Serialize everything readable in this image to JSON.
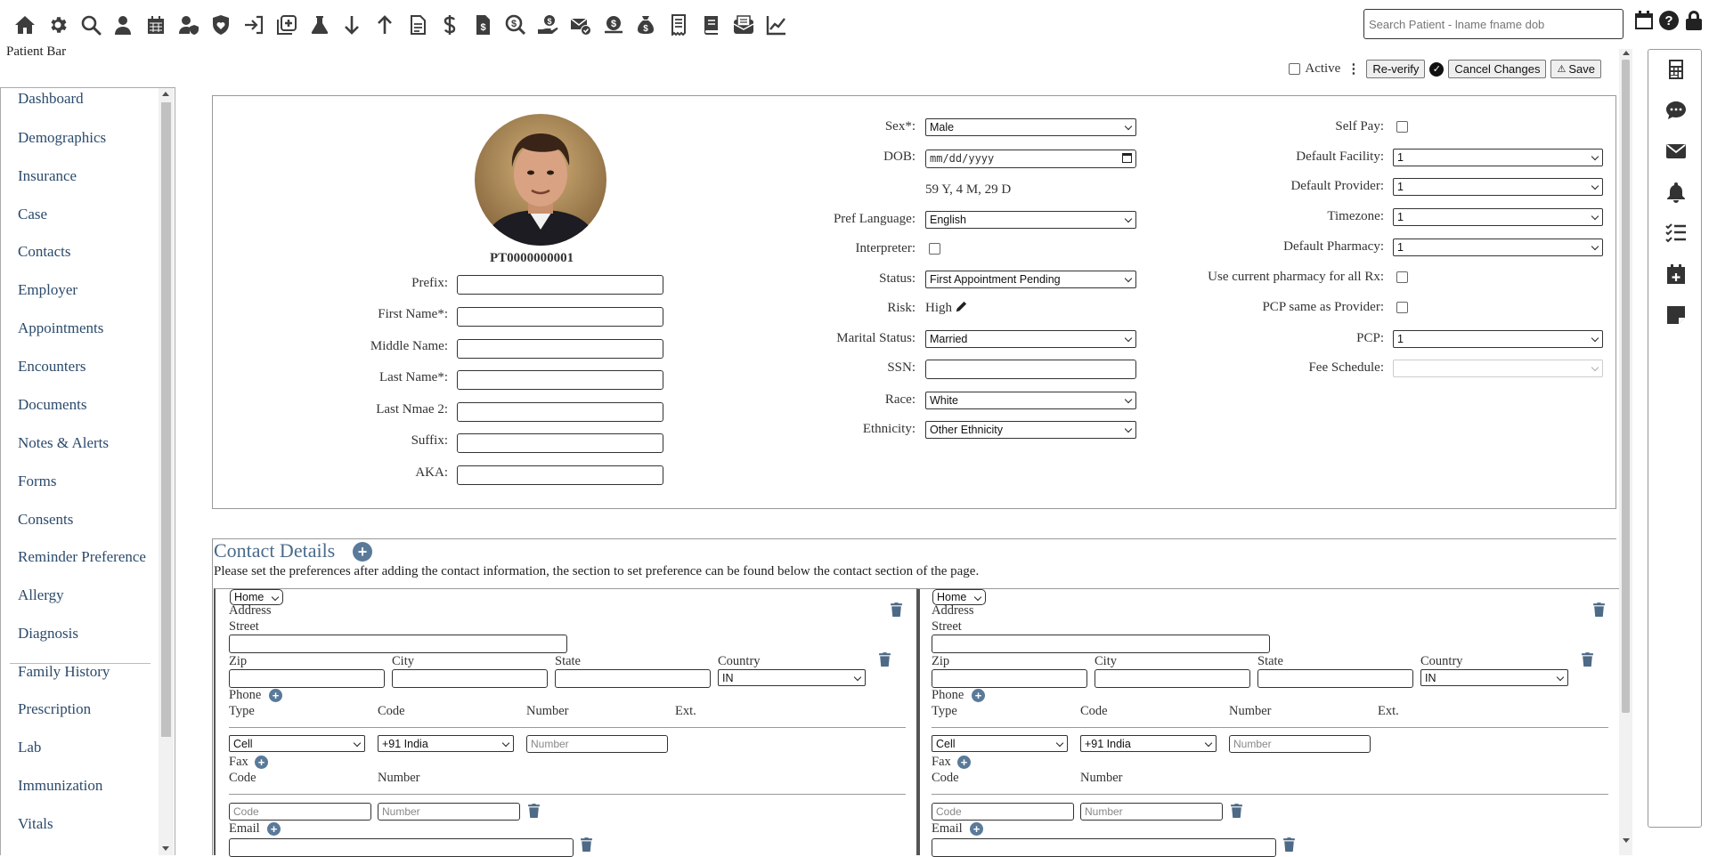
{
  "toolbar": {
    "icons": [
      "home-icon",
      "gear-icon",
      "search-icon",
      "user-icon",
      "calendar-icon",
      "user-shield-icon",
      "shield-heart-icon",
      "sign-in-icon",
      "medical-plus-icon",
      "flask-icon",
      "arrow-down-icon",
      "arrow-up-icon",
      "document-icon",
      "dollar-icon",
      "invoice-dollar-icon",
      "search-dollar-icon",
      "hand-holding-dollar-icon",
      "envelope-check-icon",
      "dollar-stack-icon",
      "money-bag-icon",
      "receipt-icon",
      "book-icon",
      "envelope-open-icon",
      "chart-line-icon"
    ],
    "patient_bar_label": "Patient Bar",
    "search_placeholder": "Search Patient - lname fname dob"
  },
  "actions": {
    "active_label": "Active",
    "reverify_label": "Re-verify",
    "cancel_label": "Cancel Changes",
    "save_label": "Save"
  },
  "sidebar": {
    "items": [
      "Dashboard",
      "Demographics",
      "Insurance",
      "Case",
      "Contacts",
      "Employer",
      "Appointments",
      "Encounters",
      "Documents",
      "Notes & Alerts",
      "Forms",
      "Consents",
      "Reminder Preference",
      "Allergy",
      "Diagnosis",
      "Family History",
      "Prescription",
      "Lab",
      "Immunization",
      "Vitals"
    ]
  },
  "patient": {
    "id": "PT0000000001",
    "name_fields": [
      "Prefix:",
      "First Name*:",
      "Middle Name:",
      "Last Name*:",
      "Last Nmae 2:",
      "Suffix:",
      "AKA:"
    ]
  },
  "demographics": {
    "sex_label": "Sex*:",
    "sex_value": "Male",
    "dob_label": "DOB:",
    "dob_placeholder": "mm/dd/yyyy",
    "age_text": "59 Y, 4 M, 29 D",
    "pref_language_label": "Pref Language:",
    "pref_language_value": "English",
    "interpreter_label": "Interpreter:",
    "status_label": "Status:",
    "status_value": "First Appointment Pending",
    "risk_label": "Risk:",
    "risk_value": "High",
    "marital_label": "Marital Status:",
    "marital_value": "Married",
    "ssn_label": "SSN:",
    "race_label": "Race:",
    "race_value": "White",
    "ethnicity_label": "Ethnicity:",
    "ethnicity_value": "Other Ethnicity"
  },
  "preferences": {
    "self_pay_label": "Self Pay:",
    "default_facility_label": "Default Facility:",
    "default_facility_value": "1",
    "default_provider_label": "Default Provider:",
    "default_provider_value": "1",
    "timezone_label": "Timezone:",
    "timezone_value": "1",
    "default_pharmacy_label": "Default Pharmacy:",
    "default_pharmacy_value": "1",
    "current_pharmacy_label": "Use current pharmacy for all Rx:",
    "pcp_same_label": "PCP same as Provider:",
    "pcp_label": "PCP:",
    "pcp_value": "1",
    "fee_schedule_label": "Fee Schedule:",
    "fee_schedule_value": ""
  },
  "contact": {
    "title": "Contact Details",
    "note": "Please set the preferences after adding the contact information, the section to set preference can be found below the contact section of the page.",
    "cards": [
      {
        "type_value": "Home",
        "address_label": "Address",
        "street_label": "Street",
        "zip_label": "Zip",
        "city_label": "City",
        "state_label": "State",
        "country_label": "Country",
        "country_value": "IN",
        "phone_label": "Phone",
        "phone_type_header": "Type",
        "phone_code_header": "Code",
        "phone_number_header": "Number",
        "phone_ext_header": "Ext.",
        "phone_type_value": "Cell",
        "phone_code_value": "+91 India",
        "phone_number_placeholder": "Number",
        "fax_label": "Fax",
        "fax_code_header": "Code",
        "fax_number_header": "Number",
        "fax_code_placeholder": "Code",
        "fax_number_placeholder": "Number",
        "email_label": "Email"
      },
      {
        "type_value": "Home",
        "address_label": "Address",
        "street_label": "Street",
        "zip_label": "Zip",
        "city_label": "City",
        "state_label": "State",
        "country_label": "Country",
        "country_value": "IN",
        "phone_label": "Phone",
        "phone_type_header": "Type",
        "phone_code_header": "Code",
        "phone_number_header": "Number",
        "phone_ext_header": "Ext.",
        "phone_type_value": "Cell",
        "phone_code_value": "+91 India",
        "phone_number_placeholder": "Number",
        "fax_label": "Fax",
        "fax_code_header": "Code",
        "fax_number_header": "Number",
        "fax_code_placeholder": "Code",
        "fax_number_placeholder": "Number",
        "email_label": "Email"
      }
    ]
  },
  "right_panel": {
    "icons": [
      "calculator-icon",
      "chat-icon",
      "envelope-icon",
      "bell-icon",
      "task-list-icon",
      "calendar-plus-icon",
      "sticky-note-icon"
    ]
  }
}
